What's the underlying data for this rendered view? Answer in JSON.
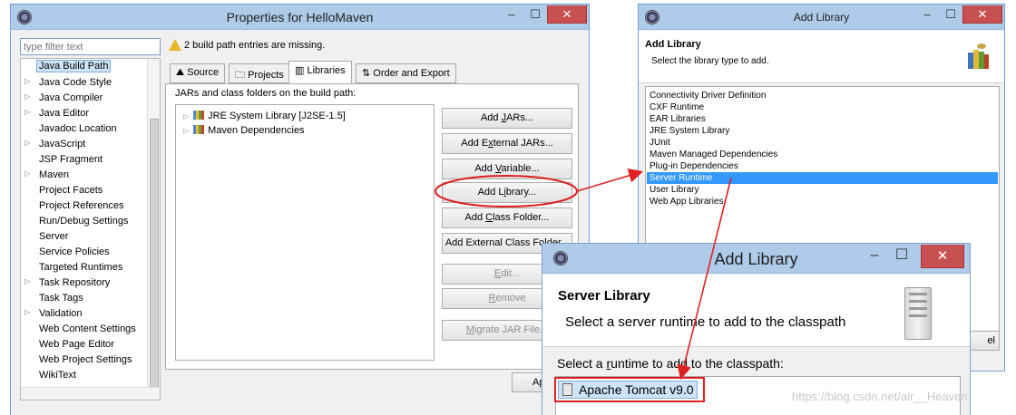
{
  "props_window": {
    "title": "Properties for HelloMaven",
    "filter_placeholder": "type filter text",
    "nav_items": [
      {
        "label": "Java Build Path",
        "expandable": false,
        "selected": true
      },
      {
        "label": "Java Code Style",
        "expandable": true
      },
      {
        "label": "Java Compiler",
        "expandable": true
      },
      {
        "label": "Java Editor",
        "expandable": true
      },
      {
        "label": "Javadoc Location",
        "expandable": false
      },
      {
        "label": "JavaScript",
        "expandable": true
      },
      {
        "label": "JSP Fragment",
        "expandable": false
      },
      {
        "label": "Maven",
        "expandable": true
      },
      {
        "label": "Project Facets",
        "expandable": false
      },
      {
        "label": "Project References",
        "expandable": false
      },
      {
        "label": "Run/Debug Settings",
        "expandable": false
      },
      {
        "label": "Server",
        "expandable": false
      },
      {
        "label": "Service Policies",
        "expandable": false
      },
      {
        "label": "Targeted Runtimes",
        "expandable": false
      },
      {
        "label": "Task Repository",
        "expandable": true
      },
      {
        "label": "Task Tags",
        "expandable": false
      },
      {
        "label": "Validation",
        "expandable": true
      },
      {
        "label": "Web Content Settings",
        "expandable": false
      },
      {
        "label": "Web Page Editor",
        "expandable": false
      },
      {
        "label": "Web Project Settings",
        "expandable": false
      },
      {
        "label": "WikiText",
        "expandable": false
      }
    ],
    "warning": "2 build path entries are missing.",
    "tabs": [
      "Source",
      "Projects",
      "Libraries",
      "Order and Export"
    ],
    "active_tab": "Libraries",
    "panel_label": "JARs and class folders on the build path:",
    "entries": [
      "JRE System Library [J2SE-1.5]",
      "Maven Dependencies"
    ],
    "buttons": [
      {
        "pre": "Add ",
        "u": "J",
        "post": "ARs...",
        "enabled": true
      },
      {
        "pre": "Add E",
        "u": "x",
        "post": "ternal JARs...",
        "enabled": true
      },
      {
        "pre": "Add ",
        "u": "V",
        "post": "ariable...",
        "enabled": true
      },
      {
        "pre": "Add L",
        "u": "i",
        "post": "brary...",
        "enabled": true
      },
      {
        "pre": "Add ",
        "u": "C",
        "post": "lass Folder...",
        "enabled": true
      },
      {
        "pre": "Add External Class Fol",
        "u": "d",
        "post": "er...",
        "enabled": true
      },
      {
        "pre": "",
        "u": "E",
        "post": "dit...",
        "enabled": false
      },
      {
        "pre": "",
        "u": "R",
        "post": "emove",
        "enabled": false
      },
      {
        "pre": "",
        "u": "M",
        "post": "igrate JAR File...",
        "enabled": false
      }
    ],
    "apply_label": "Ap"
  },
  "add_library_window": {
    "title": "Add Library",
    "header_title": "Add Library",
    "header_subtitle": "Select the library type to add.",
    "library_types": [
      "Connectivity Driver Definition",
      "CXF Runtime",
      "EAR Libraries",
      "JRE System Library",
      "JUnit",
      "Maven Managed Dependencies",
      "Plug-in Dependencies",
      "Server Runtime",
      "User Library",
      "Web App Libraries"
    ],
    "selected_type": "Server Runtime",
    "partial_button": "el"
  },
  "server_library_window": {
    "title": "Add Library",
    "header_title": "Server Library",
    "header_subtitle": "Select a server runtime to add to the classpath",
    "prompt_pre": "Select a ",
    "prompt_u": "r",
    "prompt_post": "untime to add to the classpath:",
    "runtimes": [
      "Apache Tomcat v9.0"
    ]
  },
  "watermark": "https://blog.csdn.net/air__Heaven",
  "colors": {
    "selection": "#3399ff",
    "close_button": "#c75050",
    "annotation_red": "#e02020",
    "titlebar": "#aecbe9"
  }
}
